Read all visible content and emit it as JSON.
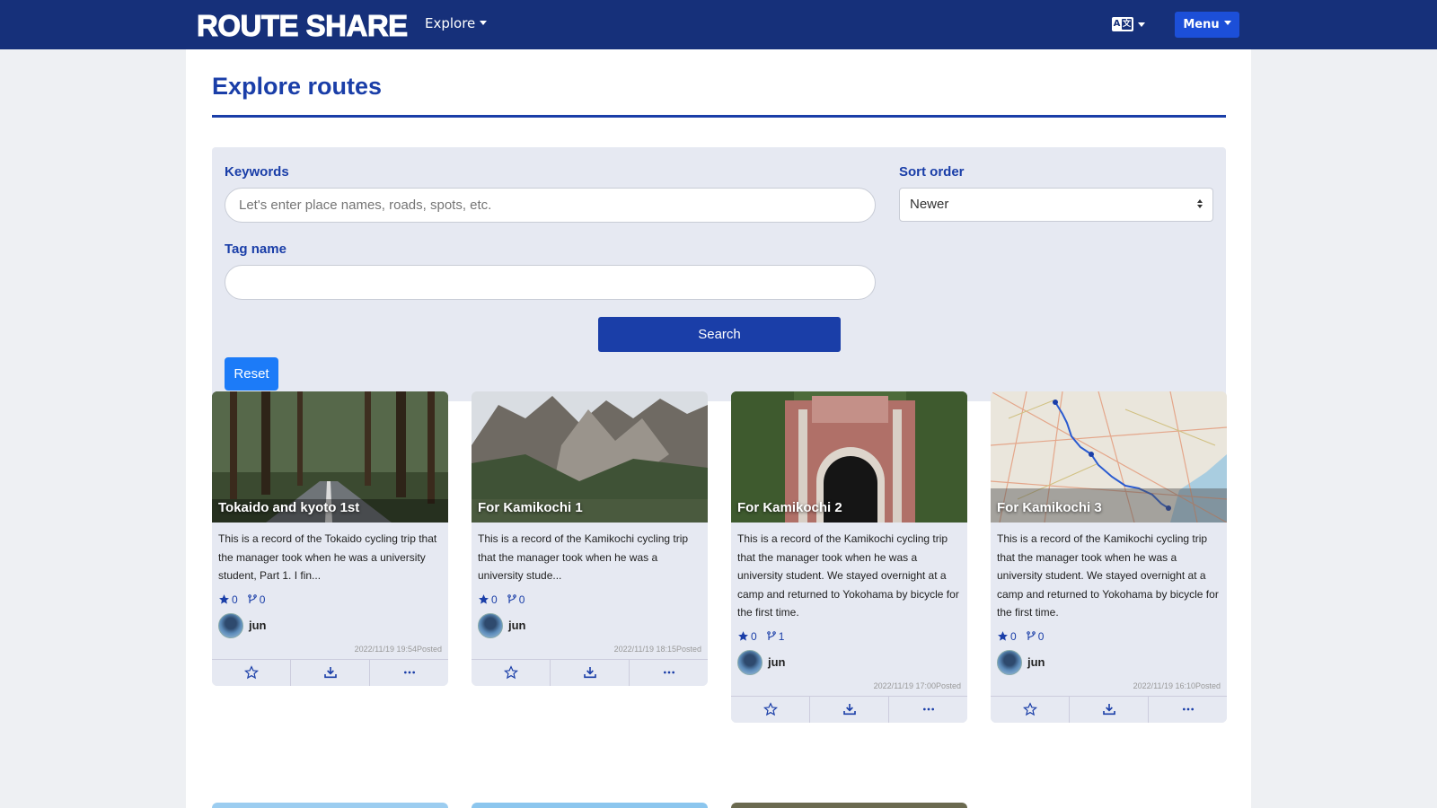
{
  "navbar": {
    "brand": "ROUTE SHARE",
    "explore_label": "Explore",
    "lang_icon": "translate-icon",
    "lang_a": "A",
    "lang_b": "文",
    "menu_label": "Menu"
  },
  "page": {
    "title": "Explore routes"
  },
  "search": {
    "keywords_label": "Keywords",
    "keywords_placeholder": "Let's enter place names, roads, spots, etc.",
    "tag_label": "Tag name",
    "tag_value": "",
    "sort_label": "Sort order",
    "sort_value": "Newer",
    "search_label": "Search",
    "reset_label": "Reset"
  },
  "cards": [
    {
      "title": "Tokaido and kyoto 1st",
      "desc": "This is a record of the Tokaido cycling trip that the manager took when he was a university student, Part 1. I fin...",
      "stars": "0",
      "forks": "0",
      "author": "jun",
      "posted": "2022/11/19 19:54Posted"
    },
    {
      "title": "For Kamikochi 1",
      "desc": "This is a record of the Kamikochi cycling trip that the manager took when he was a university stude...",
      "stars": "0",
      "forks": "0",
      "author": "jun",
      "posted": "2022/11/19 18:15Posted"
    },
    {
      "title": "For Kamikochi 2",
      "desc": "This is a record of the Kamikochi cycling trip that the manager took when he was a university student. We stayed overnight at a camp and returned to Yokohama by bicycle for the first time.",
      "stars": "0",
      "forks": "1",
      "author": "jun",
      "posted": "2022/11/19 17:00Posted"
    },
    {
      "title": "For Kamikochi 3",
      "desc": "This is a record of the Kamikochi cycling trip that the manager took when he was a university student. We stayed overnight at a camp and returned to Yokohama by bicycle for the first time.",
      "stars": "0",
      "forks": "0",
      "author": "jun",
      "posted": "2022/11/19 16:10Posted"
    }
  ],
  "colors": {
    "navbar": "#16307a",
    "accent": "#1a3ea8",
    "panel": "#e6e9f2",
    "reset": "#1c7bf8"
  }
}
